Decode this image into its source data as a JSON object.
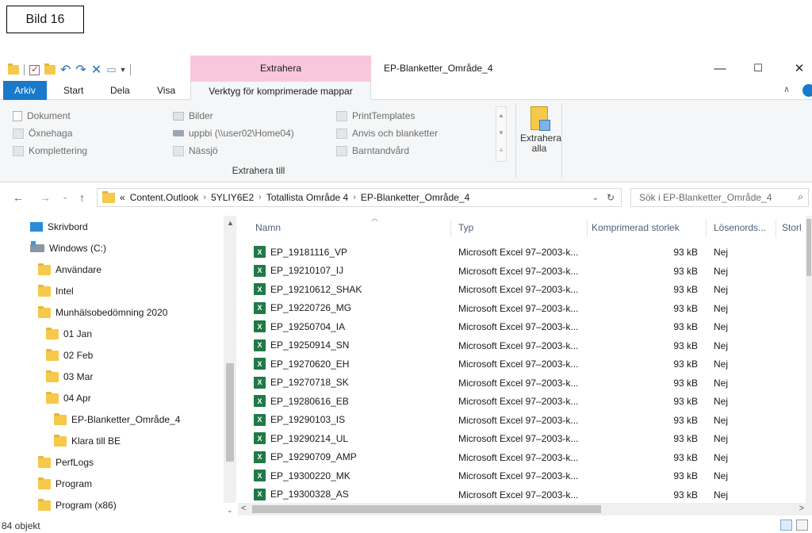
{
  "caption": "Bild 16",
  "titlebar": {
    "extract_tab_label": "Extrahera",
    "window_title": "EP-Blanketter_Område_4",
    "minimize": "—",
    "maximize": "☐",
    "close": "✕"
  },
  "ribbon_tabs": {
    "file": "Arkiv",
    "start": "Start",
    "share": "Dela",
    "view": "Visa",
    "compressed_tools": "Verktyg för komprimerade mappar"
  },
  "ribbon": {
    "col1": [
      "Dokument",
      "Öxnehaga",
      "Komplettering"
    ],
    "col2": [
      "Bilder",
      "uppbi (\\\\user02\\Home04)",
      "Nässjö"
    ],
    "col3": [
      "PrintTemplates",
      "Anvis och blanketter",
      "Barntandvård"
    ],
    "group_label": "Extrahera till",
    "extract_all": "Extrahera alla"
  },
  "address": {
    "overflow": "«",
    "crumbs": [
      "Content.Outlook",
      "5YLIY6E2",
      "Totallista Område 4",
      "EP-Blanketter_Område_4"
    ],
    "search_placeholder": "Sök i EP-Blanketter_Område_4"
  },
  "nav": {
    "items": [
      "Skrivbord",
      "Windows (C:)",
      "Användare",
      "Intel",
      "Munhälsobedömning 2020",
      "01 Jan",
      "02 Feb",
      "03 Mar",
      "04 Apr",
      "EP-Blanketter_Område_4",
      "Klara till BE",
      "PerfLogs",
      "Program",
      "Program (x86)"
    ]
  },
  "columns": {
    "name": "Namn",
    "type": "Typ",
    "compressed_size": "Komprimerad storlek",
    "password": "Lösenords...",
    "size": "Storl"
  },
  "files": [
    {
      "name": "EP_19181116_VP",
      "type": "Microsoft Excel 97–2003-k...",
      "size": "93 kB",
      "pw": "Nej"
    },
    {
      "name": "EP_19210107_IJ",
      "type": "Microsoft Excel 97–2003-k...",
      "size": "93 kB",
      "pw": "Nej"
    },
    {
      "name": "EP_19210612_SHAK",
      "type": "Microsoft Excel 97–2003-k...",
      "size": "93 kB",
      "pw": "Nej"
    },
    {
      "name": "EP_19220726_MG",
      "type": "Microsoft Excel 97–2003-k...",
      "size": "93 kB",
      "pw": "Nej"
    },
    {
      "name": "EP_19250704_IA",
      "type": "Microsoft Excel 97–2003-k...",
      "size": "93 kB",
      "pw": "Nej"
    },
    {
      "name": "EP_19250914_SN",
      "type": "Microsoft Excel 97–2003-k...",
      "size": "93 kB",
      "pw": "Nej"
    },
    {
      "name": "EP_19270620_EH",
      "type": "Microsoft Excel 97–2003-k...",
      "size": "93 kB",
      "pw": "Nej"
    },
    {
      "name": "EP_19270718_SK",
      "type": "Microsoft Excel 97–2003-k...",
      "size": "93 kB",
      "pw": "Nej"
    },
    {
      "name": "EP_19280616_EB",
      "type": "Microsoft Excel 97–2003-k...",
      "size": "93 kB",
      "pw": "Nej"
    },
    {
      "name": "EP_19290103_IS",
      "type": "Microsoft Excel 97–2003-k...",
      "size": "93 kB",
      "pw": "Nej"
    },
    {
      "name": "EP_19290214_UL",
      "type": "Microsoft Excel 97–2003-k...",
      "size": "93 kB",
      "pw": "Nej"
    },
    {
      "name": "EP_19290709_AMP",
      "type": "Microsoft Excel 97–2003-k...",
      "size": "93 kB",
      "pw": "Nej"
    },
    {
      "name": "EP_19300220_MK",
      "type": "Microsoft Excel 97–2003-k...",
      "size": "93 kB",
      "pw": "Nej"
    },
    {
      "name": "EP_19300328_AS",
      "type": "Microsoft Excel 97–2003-k...",
      "size": "93 kB",
      "pw": "Nej"
    }
  ],
  "status": {
    "count": "84 objekt"
  },
  "colors": {
    "accent": "#1979ca",
    "extract_tab": "#f9c7dc",
    "folder": "#f6c94b",
    "excel": "#1f7a45"
  }
}
